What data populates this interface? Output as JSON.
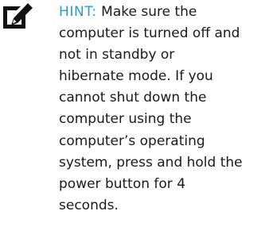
{
  "note": {
    "icon": "pencil-note-icon",
    "label": "HINT:",
    "label_color": "#1e9fd2",
    "lines": [
      "Make sure the",
      "computer is turned off and",
      "not in standby or",
      "hibernate mode. If you",
      "cannot shut down the",
      "computer using the",
      "computer’s operating",
      "system, press and hold the",
      "power button for 4",
      "seconds."
    ]
  }
}
